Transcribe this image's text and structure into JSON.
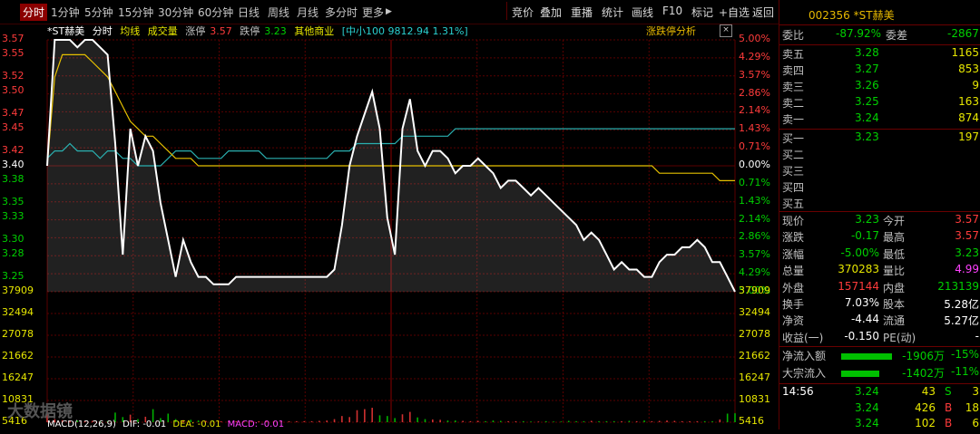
{
  "toolbar": {
    "period_tabs": [
      "分时",
      "1分钟",
      "5分钟",
      "15分钟",
      "30分钟",
      "60分钟",
      "日线",
      "周线",
      "月线",
      "多分时",
      "更多"
    ],
    "more_arrow": "▶",
    "right_buttons": [
      "竞价",
      "叠加",
      "重播",
      "统计",
      "画线",
      "F10",
      "标记",
      "+自选",
      "返回"
    ]
  },
  "legend": {
    "name": "*ST赫美",
    "mode": "分时",
    "avg_label": "均线",
    "vol_label": "成交量",
    "limit_up_label": "涨停",
    "limit_up": "3.57",
    "limit_down_label": "跌停",
    "limit_down": "3.23",
    "industry": "其他商业",
    "index_text": "[中小100 9812.94 1.31%]",
    "zdt_label": "涨跌停分析",
    "close_glyph": "×",
    "settings_glyph": "⚙"
  },
  "axes": {
    "left_prices": [
      "3.57",
      "3.55",
      "3.52",
      "3.50",
      "3.47",
      "3.45",
      "3.42",
      "3.40",
      "3.38",
      "3.35",
      "3.33",
      "3.30",
      "3.28",
      "3.25"
    ],
    "right_pcts": [
      "5.00%",
      "4.29%",
      "3.57%",
      "2.86%",
      "2.14%",
      "1.43%",
      "0.71%",
      "0.00%",
      "0.71%",
      "1.43%",
      "2.14%",
      "2.86%",
      "3.57%",
      "4.29%",
      "5.00%"
    ],
    "vol_labels": [
      "37909",
      "32494",
      "27078",
      "21662",
      "16247",
      "10831",
      "5416"
    ],
    "vol_labels_right": [
      "37909",
      "32494",
      "27078",
      "21662",
      "16247",
      "10831",
      "5416"
    ]
  },
  "macd": {
    "label": "MACD(12,26,9)",
    "dif": "DIF: -0.01",
    "dea": "DEA: -0.01",
    "macd": "MACD: -0.01"
  },
  "watermark": "大数据镜",
  "colors": {
    "up": "#ff3b3b",
    "down": "#00d000",
    "price_line": "#ffffff",
    "avg_line": "#e6c000",
    "index_line": "#2ab0b0",
    "grid": "#5a0000"
  },
  "chart_data": {
    "type": "line",
    "prev_close": 3.4,
    "price_ylim": [
      3.23,
      3.57
    ],
    "vol_ylim": [
      0,
      37909
    ],
    "series": [
      {
        "values": [
          3.4,
          3.57,
          3.57,
          3.57,
          3.56,
          3.57,
          3.57,
          3.56,
          3.55,
          3.43,
          3.28,
          3.45,
          3.4,
          3.44,
          3.42,
          3.35,
          3.3,
          3.25,
          3.3,
          3.27,
          3.25,
          3.25,
          3.24,
          3.24,
          3.24,
          3.25,
          3.25,
          3.25,
          3.25,
          3.25,
          3.25,
          3.25,
          3.25,
          3.25,
          3.25,
          3.25,
          3.25,
          3.25,
          3.26,
          3.32,
          3.4,
          3.44,
          3.47,
          3.5,
          3.45,
          3.33,
          3.28,
          3.45,
          3.49,
          3.42,
          3.4,
          3.42,
          3.42,
          3.41,
          3.39,
          3.4,
          3.4,
          3.41,
          3.4,
          3.39,
          3.37,
          3.38,
          3.38,
          3.37,
          3.36,
          3.37,
          3.36,
          3.35,
          3.34,
          3.33,
          3.32,
          3.3,
          3.31,
          3.3,
          3.28,
          3.26,
          3.27,
          3.26,
          3.26,
          3.25,
          3.25,
          3.27,
          3.28,
          3.28,
          3.29,
          3.29,
          3.3,
          3.29,
          3.27,
          3.27,
          3.25,
          3.23
        ]
      },
      {
        "values": [
          3.4,
          3.52,
          3.55,
          3.55,
          3.55,
          3.55,
          3.54,
          3.53,
          3.52,
          3.5,
          3.48,
          3.46,
          3.45,
          3.44,
          3.44,
          3.43,
          3.42,
          3.41,
          3.41,
          3.41,
          3.4,
          3.4,
          3.4,
          3.4,
          3.4,
          3.4,
          3.4,
          3.4,
          3.4,
          3.4,
          3.4,
          3.4,
          3.4,
          3.4,
          3.4,
          3.4,
          3.4,
          3.4,
          3.4,
          3.4,
          3.4,
          3.4,
          3.4,
          3.4,
          3.4,
          3.4,
          3.4,
          3.4,
          3.4,
          3.4,
          3.4,
          3.4,
          3.4,
          3.4,
          3.4,
          3.4,
          3.4,
          3.4,
          3.4,
          3.4,
          3.4,
          3.4,
          3.4,
          3.4,
          3.4,
          3.4,
          3.4,
          3.4,
          3.4,
          3.4,
          3.4,
          3.4,
          3.4,
          3.4,
          3.4,
          3.4,
          3.4,
          3.4,
          3.4,
          3.4,
          3.4,
          3.39,
          3.39,
          3.39,
          3.39,
          3.39,
          3.39,
          3.39,
          3.39,
          3.38,
          3.38,
          3.38
        ]
      },
      {
        "values": [
          3.41,
          3.42,
          3.42,
          3.43,
          3.42,
          3.42,
          3.42,
          3.41,
          3.42,
          3.42,
          3.41,
          3.41,
          3.4,
          3.4,
          3.4,
          3.4,
          3.41,
          3.42,
          3.42,
          3.42,
          3.41,
          3.41,
          3.41,
          3.41,
          3.42,
          3.42,
          3.42,
          3.42,
          3.42,
          3.41,
          3.41,
          3.41,
          3.41,
          3.41,
          3.41,
          3.41,
          3.41,
          3.41,
          3.42,
          3.42,
          3.42,
          3.43,
          3.43,
          3.43,
          3.43,
          3.43,
          3.43,
          3.44,
          3.44,
          3.44,
          3.44,
          3.44,
          3.44,
          3.44,
          3.45,
          3.45,
          3.45,
          3.45,
          3.45,
          3.45,
          3.45,
          3.45,
          3.45,
          3.45,
          3.45,
          3.45,
          3.45,
          3.45,
          3.45,
          3.45,
          3.45,
          3.45,
          3.45,
          3.45,
          3.45,
          3.45,
          3.45,
          3.45,
          3.45,
          3.45,
          3.45,
          3.45,
          3.45,
          3.45,
          3.45,
          3.45,
          3.45,
          3.45,
          3.45,
          3.45,
          3.45,
          3.45
        ]
      }
    ],
    "volumes": [
      3500,
      900,
      600,
      500,
      500,
      400,
      400,
      300,
      350,
      2800,
      1500,
      2200,
      900,
      1600,
      3800,
      1200,
      2500,
      900,
      600,
      700,
      500,
      400,
      400,
      300,
      300,
      300,
      300,
      300,
      300,
      300,
      300,
      300,
      300,
      300,
      300,
      300,
      400,
      500,
      900,
      1800,
      1500,
      3500,
      3800,
      4200,
      2000,
      1800,
      1200,
      2300,
      3000,
      1400,
      900,
      800,
      700,
      500,
      500,
      400,
      300,
      400,
      300,
      500,
      400,
      300,
      300,
      300,
      200,
      200,
      300,
      200,
      200,
      400,
      300,
      300,
      400,
      300,
      300,
      300,
      300,
      400,
      300,
      500,
      300,
      400,
      500,
      400,
      300,
      300,
      300,
      300,
      300,
      800,
      2500,
      2600
    ]
  },
  "side": {
    "header": "002356 *ST赫美",
    "weibi_label": "委比",
    "weibi": "-87.92%",
    "weicha_label": "委差",
    "weicha": "-2867",
    "asks": [
      {
        "label": "卖五",
        "price": "3.28",
        "vol": "1165"
      },
      {
        "label": "卖四",
        "price": "3.27",
        "vol": "853"
      },
      {
        "label": "卖三",
        "price": "3.26",
        "vol": "9"
      },
      {
        "label": "卖二",
        "price": "3.25",
        "vol": "163"
      },
      {
        "label": "卖一",
        "price": "3.24",
        "vol": "874"
      }
    ],
    "bids": [
      {
        "label": "买一",
        "price": "3.23",
        "vol": "197"
      },
      {
        "label": "买二",
        "price": "",
        "vol": ""
      },
      {
        "label": "买三",
        "price": "",
        "vol": ""
      },
      {
        "label": "买四",
        "price": "",
        "vol": ""
      },
      {
        "label": "买五",
        "price": "",
        "vol": ""
      }
    ],
    "quote": [
      {
        "l": "现价",
        "v": "3.23",
        "l2": "今开",
        "v2": "3.57"
      },
      {
        "l": "涨跌",
        "v": "-0.17",
        "l2": "最高",
        "v2": "3.57"
      },
      {
        "l": "涨幅",
        "v": "-5.00%",
        "l2": "最低",
        "v2": "3.23"
      },
      {
        "l": "总量",
        "v": "370283",
        "l2": "量比",
        "v2": "4.99"
      },
      {
        "l": "外盘",
        "v": "157144",
        "l2": "内盘",
        "v2": "213139"
      },
      {
        "l": "换手",
        "v": "7.03%",
        "l2": "股本",
        "v2": "5.28亿"
      },
      {
        "l": "净资",
        "v": "-4.44",
        "l2": "流通",
        "v2": "5.27亿"
      },
      {
        "l": "收益(一)",
        "v": "-0.150",
        "l2": "PE(动)",
        "v2": "-"
      }
    ],
    "flows": [
      {
        "l": "净流入额",
        "v": "-1906万",
        "p": "-15%",
        "bar": 0.8
      },
      {
        "l": "大宗流入",
        "v": "-1402万",
        "p": "-11%",
        "bar": 0.6
      }
    ],
    "ticks": [
      {
        "t": "14:56",
        "p": "3.24",
        "v": "43",
        "s": "S",
        "n": "3"
      },
      {
        "t": "",
        "p": "3.24",
        "v": "426",
        "s": "B",
        "n": "18"
      },
      {
        "t": "",
        "p": "3.24",
        "v": "102",
        "s": "B",
        "n": "6"
      }
    ]
  }
}
